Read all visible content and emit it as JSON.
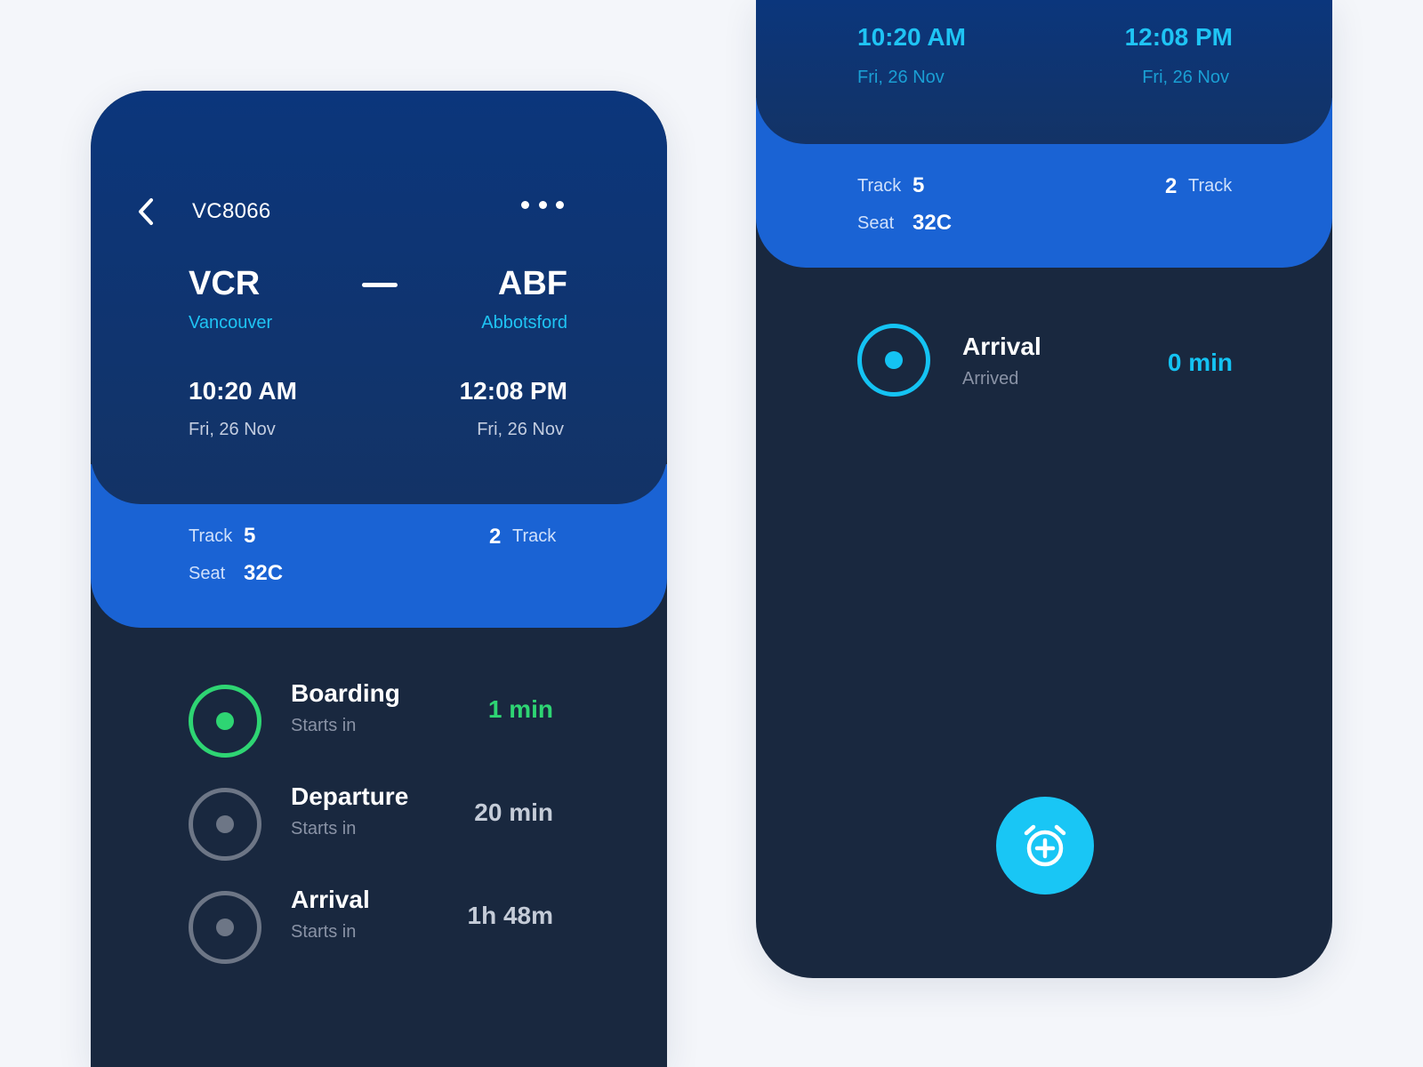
{
  "left": {
    "header": {
      "flight_code": "VC8066",
      "origin_code": "VCR",
      "origin_city": "Vancouver",
      "dest_code": "ABF",
      "dest_city": "Abbotsford",
      "depart_time": "10:20 AM",
      "depart_date": "Fri, 26 Nov",
      "arrive_time": "12:08 PM",
      "arrive_date": "Fri, 26 Nov"
    },
    "band": {
      "track_label": "Track",
      "track_value": "5",
      "seat_label": "Seat",
      "seat_value": "32C",
      "right_value": "2",
      "right_label": "Track"
    },
    "statuses": [
      {
        "title": "Boarding",
        "subtitle": "Starts in",
        "value": "1 min",
        "state": "active",
        "color": "#2ed573"
      },
      {
        "title": "Departure",
        "subtitle": "Starts in",
        "value": "20 min",
        "state": "pending",
        "color": "#6d7686"
      },
      {
        "title": "Arrival",
        "subtitle": "Starts in",
        "value": "1h 48m",
        "state": "pending",
        "color": "#6d7686"
      }
    ]
  },
  "right": {
    "header": {
      "depart_time": "10:20 AM",
      "depart_date": "Fri, 26 Nov",
      "arrive_time": "12:08 PM",
      "arrive_date": "Fri, 26 Nov"
    },
    "band": {
      "track_label": "Track",
      "track_value": "5",
      "seat_label": "Seat",
      "seat_value": "32C",
      "right_value": "2",
      "right_label": "Track"
    },
    "status": {
      "title": "Arrival",
      "subtitle": "Arrived",
      "value": "0 min",
      "color": "#14c3f3"
    },
    "fab_icon": "alarm-add-icon"
  },
  "colors": {
    "background": "#f4f6fa",
    "header_dark": "#0b367c",
    "band_blue": "#1a63d4",
    "body_dark": "#19283f",
    "accent_cyan": "#1fc4f4",
    "accent_green": "#2ed573",
    "muted_gray": "#6d7686"
  }
}
